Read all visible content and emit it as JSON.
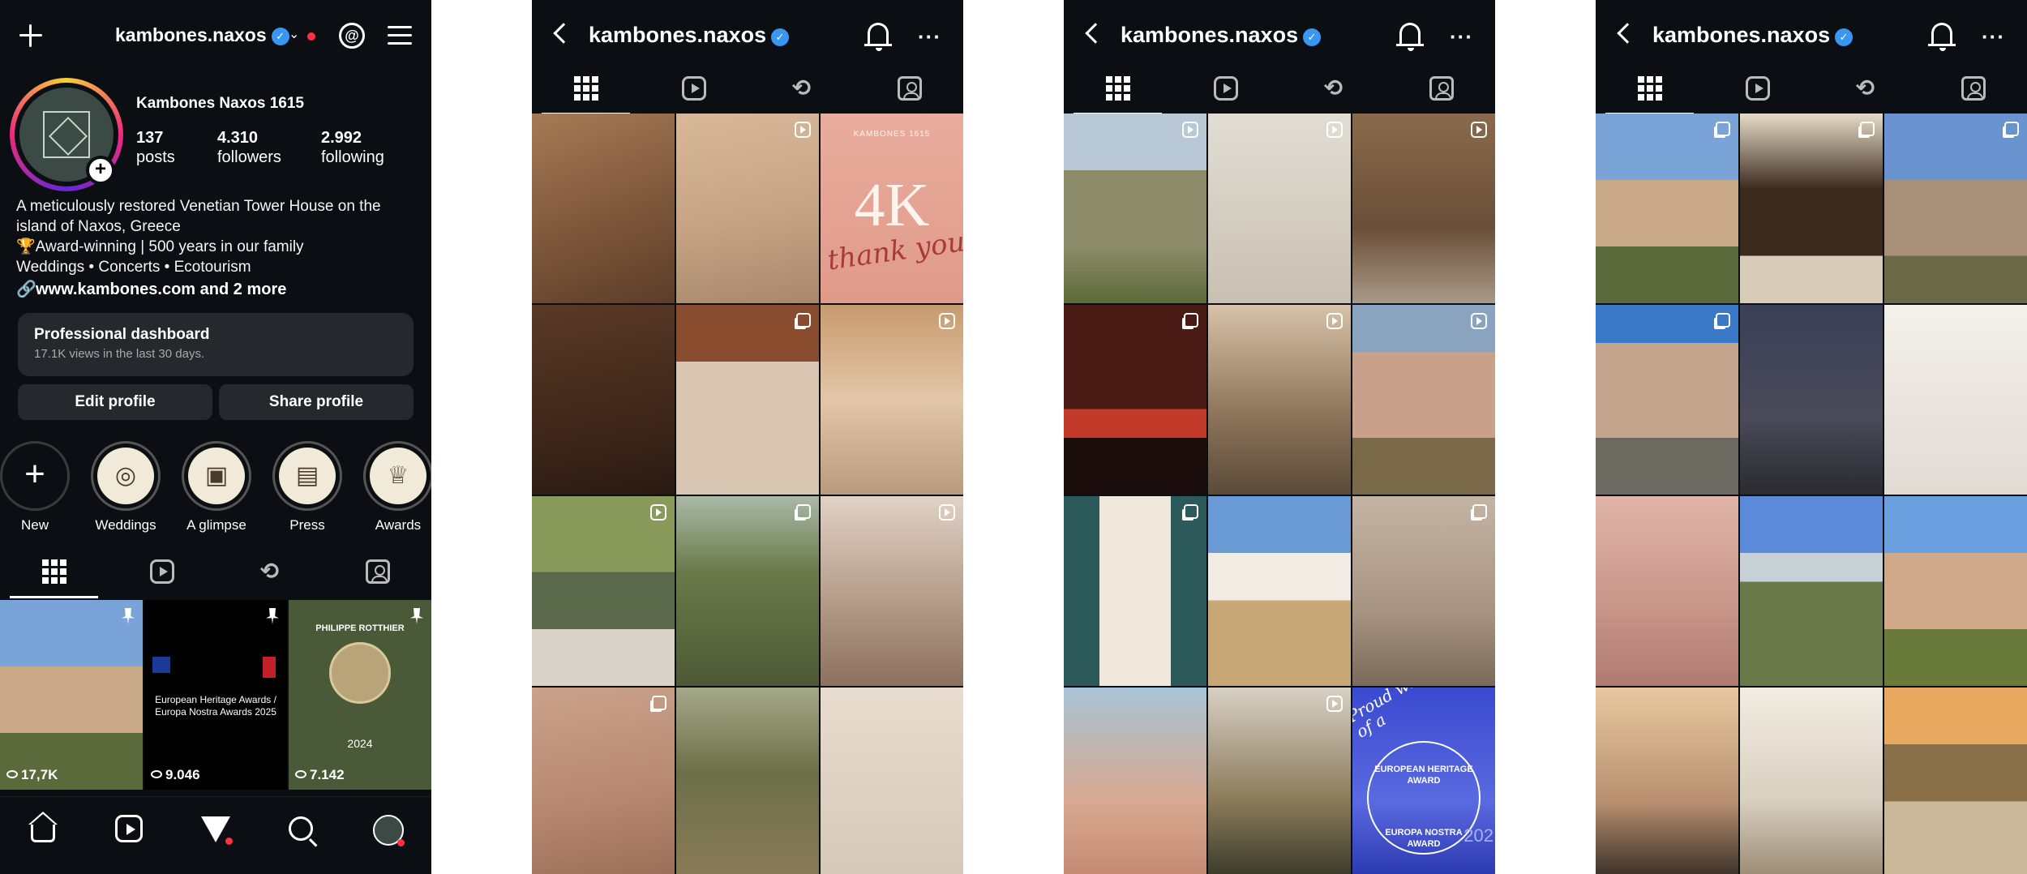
{
  "colors": {
    "background": "#0b0f14",
    "verified": "#3897f0",
    "notification": "#ff3040",
    "button": "#25292e"
  },
  "panel1": {
    "username": "kambones.naxos",
    "full_name": "Kambones Naxos 1615",
    "stats": [
      {
        "number": "137",
        "label": "posts"
      },
      {
        "number": "4.310",
        "label": "followers"
      },
      {
        "number": "2.992",
        "label": "following"
      }
    ],
    "bio": [
      "A meticulously restored Venetian Tower House on the",
      "island of Naxos, Greece",
      "🏆Award-winning | 500 years in our family",
      "Weddings • Concerts • Ecotourism"
    ],
    "link": "www.kambones.com and 2 more",
    "dashboard": {
      "title": "Professional dashboard",
      "subtitle": "17.1K views in the last 30 days."
    },
    "buttons": {
      "edit": "Edit profile",
      "share": "Share profile"
    },
    "highlights": [
      {
        "label": "New",
        "icon": "plus-icon"
      },
      {
        "label": "Weddings",
        "icon": "rings-icon"
      },
      {
        "label": "A glimpse",
        "icon": "photos-icon"
      },
      {
        "label": "Press",
        "icon": "newspaper-icon"
      },
      {
        "label": "Awards",
        "icon": "trophy-icon"
      }
    ],
    "posts": [
      {
        "views": "17,7K",
        "pinned": true
      },
      {
        "views": "9.046",
        "pinned": true,
        "text": [
          "European Heritage Awards /",
          "Europa Nostra Awards 2025"
        ]
      },
      {
        "views": "7.142",
        "pinned": true,
        "text": [
          "PHILIPPE ROTTHIER",
          "2024"
        ]
      }
    ]
  },
  "grid_panels": [
    {
      "title": "kambones.naxos",
      "cells": [
        {
          "badge": ""
        },
        {
          "badge": "reel"
        },
        {
          "badge": "",
          "big": "4K",
          "script": "thank you",
          "brand": "KAMBONES 1615"
        },
        {
          "badge": ""
        },
        {
          "badge": "multi"
        },
        {
          "badge": "reel"
        },
        {
          "badge": "reel"
        },
        {
          "badge": "multi"
        },
        {
          "badge": "reel"
        },
        {
          "badge": "multi"
        },
        {
          "badge": ""
        },
        {
          "badge": ""
        }
      ]
    },
    {
      "title": "kambones.naxos",
      "cells": [
        {
          "badge": "reel"
        },
        {
          "badge": "reel"
        },
        {
          "badge": "reel"
        },
        {
          "badge": "multi"
        },
        {
          "badge": "reel"
        },
        {
          "badge": "reel"
        },
        {
          "badge": "multi"
        },
        {
          "badge": ""
        },
        {
          "badge": "multi"
        },
        {
          "badge": ""
        },
        {
          "badge": "reel"
        },
        {
          "badge": "",
          "award_text": "Proud winner of a",
          "award_ring": "EUROPEAN HERITAGE AWARD",
          "award_ring2": "EUROPA NOSTRA AWARD",
          "award_year": "202"
        }
      ]
    },
    {
      "title": "kambones.naxos",
      "cells": [
        {
          "badge": "multi"
        },
        {
          "badge": "multi"
        },
        {
          "badge": "multi"
        },
        {
          "badge": "multi"
        },
        {
          "badge": ""
        },
        {
          "badge": ""
        },
        {
          "badge": ""
        },
        {
          "badge": ""
        },
        {
          "badge": ""
        },
        {
          "badge": ""
        },
        {
          "badge": ""
        },
        {
          "badge": ""
        }
      ]
    }
  ]
}
